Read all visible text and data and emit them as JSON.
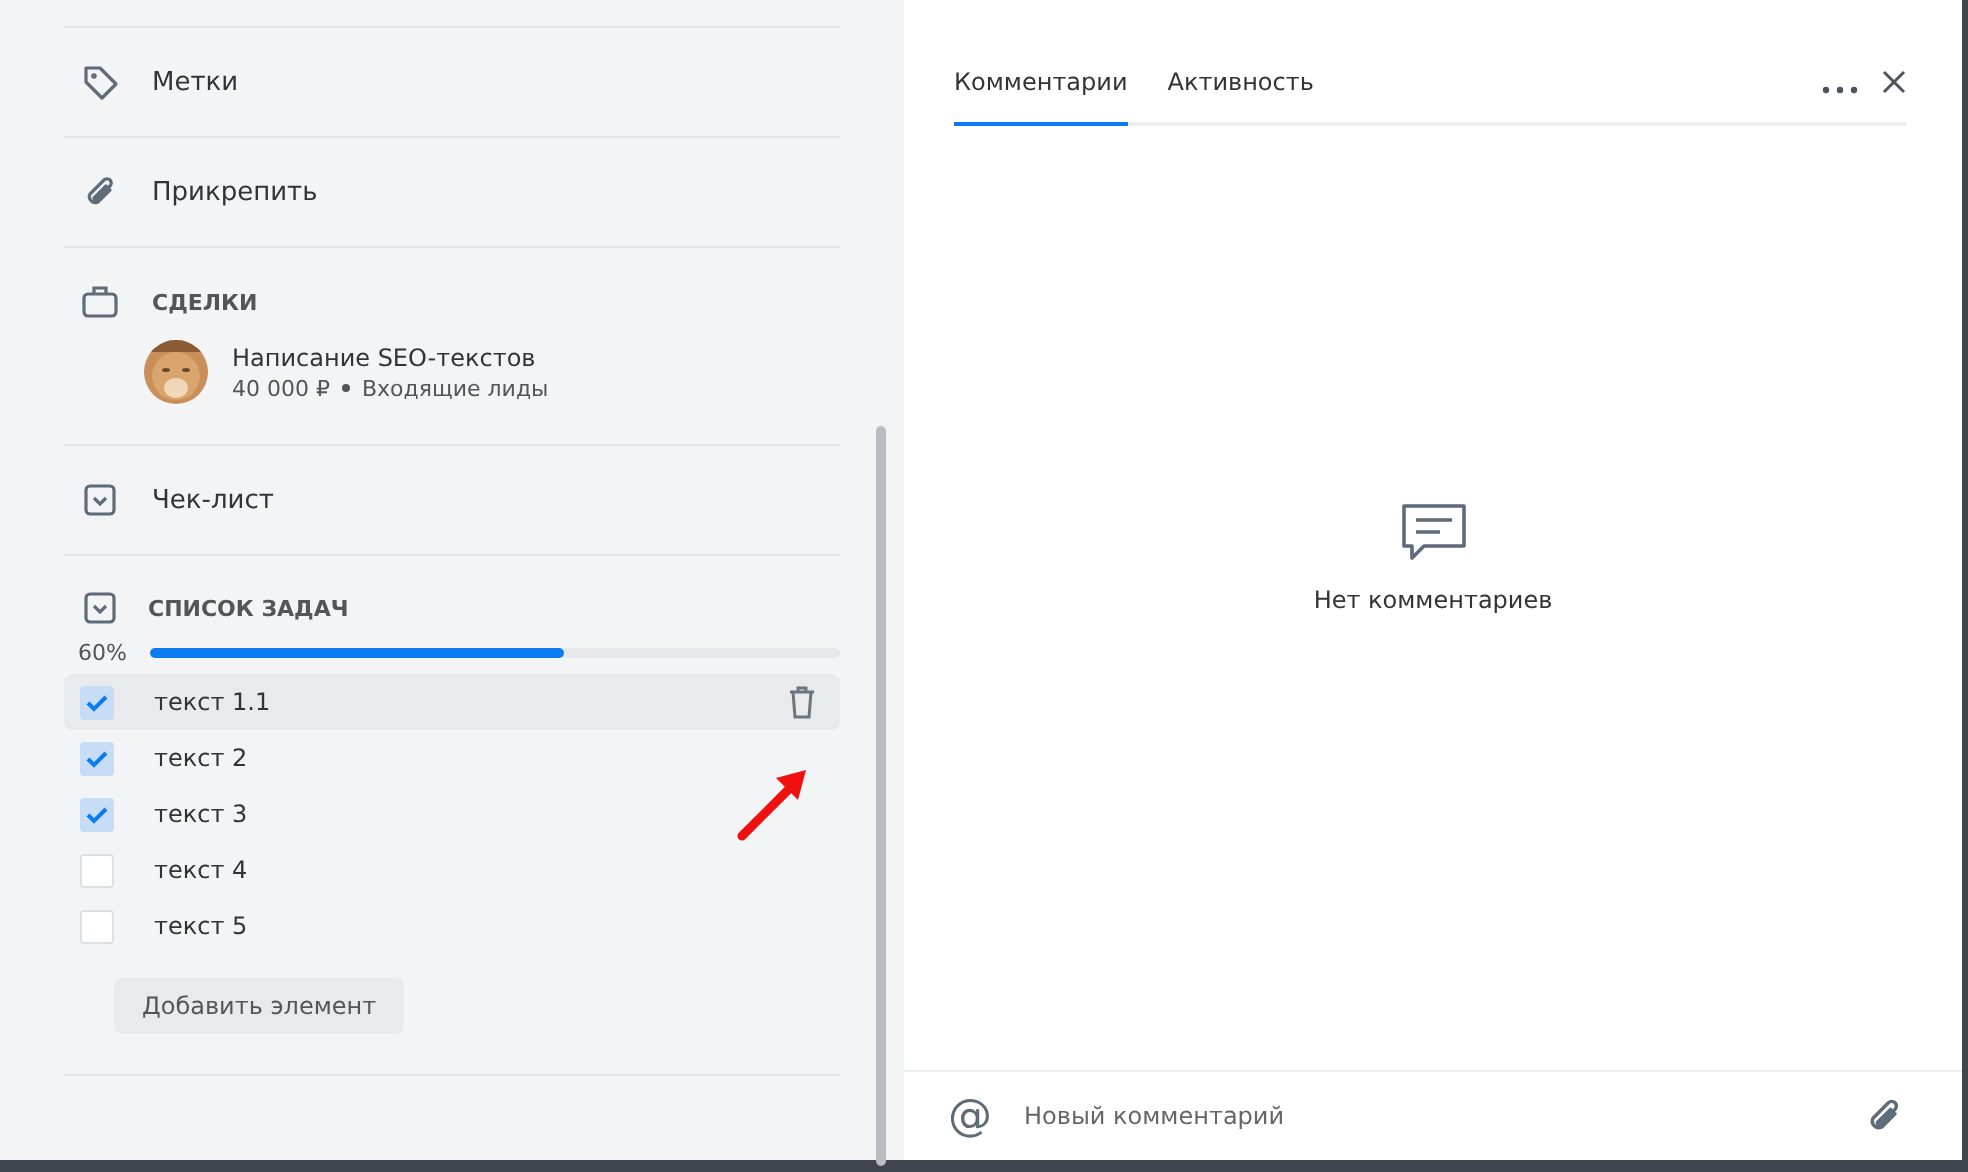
{
  "sidebar": {
    "items": [
      {
        "kind": "link",
        "label": "Метки"
      },
      {
        "kind": "link",
        "label": "Прикрепить"
      },
      {
        "kind": "deals",
        "label": "СДЕЛКИ",
        "deal": {
          "title": "Написание SEO-текстов",
          "amount": "40 000 ₽",
          "stage": "Входящие лиды"
        }
      },
      {
        "kind": "link",
        "label": "Чек-лист"
      }
    ]
  },
  "task_list": {
    "title": "СПИСОК ЗАДАЧ",
    "percent": "60%",
    "level": 0.6,
    "items": [
      {
        "text": "текст 1.1",
        "checked": true,
        "selected": true
      },
      {
        "text": "текст 2",
        "checked": true,
        "selected": false
      },
      {
        "text": "текст 3",
        "checked": true,
        "selected": false
      },
      {
        "text": "текст 4",
        "checked": false,
        "selected": false
      },
      {
        "text": "текст 5",
        "checked": false,
        "selected": false
      }
    ],
    "add_button": "Добавить элемент"
  },
  "tabs": [
    {
      "label": "Комментарии",
      "selected": true
    },
    {
      "label": "Активность",
      "selected": false
    }
  ],
  "empty_text": "Нет комментариев",
  "comment_input": {
    "mention": "@",
    "placeholder": "Новый комментарий"
  }
}
